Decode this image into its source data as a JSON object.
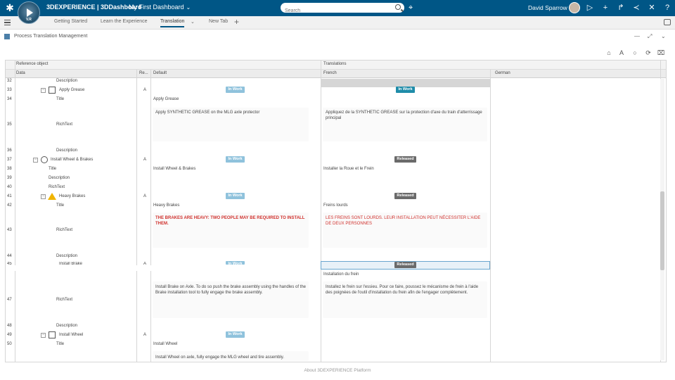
{
  "topbar": {
    "brand": "3DEXPERIENCE | 3DDashboard",
    "dashboard_title": "My First Dashboard",
    "compass_version": "V.R",
    "search_placeholder": "Search",
    "user_name": "David Sparrow"
  },
  "tabs": {
    "items": [
      "Getting Started",
      "Learn the Experience",
      "Translation",
      "New Tab"
    ],
    "active": "Translation"
  },
  "widget": {
    "title": "Process Translation Management"
  },
  "grid": {
    "group_headers": {
      "reference": "Reference object",
      "translations": "Translations"
    },
    "columns": {
      "data": "Data",
      "rev": "Re...",
      "default": "Default",
      "french": "French",
      "german": "German"
    },
    "rows": [
      {
        "num": "32",
        "data": "Description"
      },
      {
        "num": "33",
        "data": "Apply Grease",
        "rev": "A",
        "default_badge": "In Work",
        "french_badge": "In Work"
      },
      {
        "num": "34",
        "data": "Title",
        "default": "Apply Grease"
      },
      {
        "num": "35",
        "data": "RichText",
        "default": "Apply SYNTHETIC GREASE on the MLG axle protector",
        "french": "Appliquez de la SYNTHETIC GREASE sur la protection d'axe du train d'atterrissage principal"
      },
      {
        "num": "36",
        "data": "Description"
      },
      {
        "num": "37",
        "data": "Install Wheel & Brakes",
        "rev": "A",
        "default_badge": "In Work",
        "french_badge": "Released"
      },
      {
        "num": "38",
        "data": "Title",
        "default": "Install Wheel & Brakes",
        "french": "Installer la Roue et le Frein"
      },
      {
        "num": "39",
        "data": "Description"
      },
      {
        "num": "40",
        "data": "RichText"
      },
      {
        "num": "41",
        "data": "Heavy Brakes",
        "rev": "A",
        "default_badge": "In Work",
        "french_badge": "Released"
      },
      {
        "num": "42",
        "data": "Title",
        "default": "Heavy Brakes",
        "french": "Freins lourds"
      },
      {
        "num": "43",
        "data": "RichText",
        "default": "THE BRAKES ARE HEAVY: TWO PEOPLE MAY BE REQUIRED TO INSTALL THEM.",
        "french": "LES FREINS SONT LOURDS. LEUR INSTALLATION PEUT NÉCESSITER L'AIDE DE DEUX PERSONNES"
      },
      {
        "num": "44",
        "data": "Description"
      },
      {
        "num": "45",
        "data": "Install Brake",
        "rev": "A",
        "default_badge": "In Work",
        "french_badge": "Released"
      },
      {
        "num": "46",
        "data": "Title",
        "french": "Installation du frein"
      },
      {
        "num": "47",
        "data": "RichText",
        "default": "Install Brake on Axle. To do so push the brake assembly using the handles of the Brake installation tool to fully engage the brake assembly.",
        "french": "Installez le frein sur l'essieu. Pour ce faire, poussez le mécanisme de frein à l'aide des poignées de l'outil d'installation du frein afin de l'engager complètement."
      },
      {
        "num": "48",
        "data": "Description"
      },
      {
        "num": "49",
        "data": "Install Wheel",
        "rev": "A",
        "default_badge": "In Work"
      },
      {
        "num": "50",
        "data": "Title",
        "default": "Install Wheel"
      },
      {
        "num": "51",
        "default": "Install Wheel on axle, fully engage the MLG wheel and tire assembly."
      }
    ]
  },
  "footer": {
    "text": "About 3DEXPERIENCE Platform"
  },
  "colors": {
    "topbar": "#005686",
    "in_work": "#8fc2dc",
    "in_work_active": "#1f8ca9",
    "released": "#6a6a6a",
    "warning": "#d0312d"
  }
}
